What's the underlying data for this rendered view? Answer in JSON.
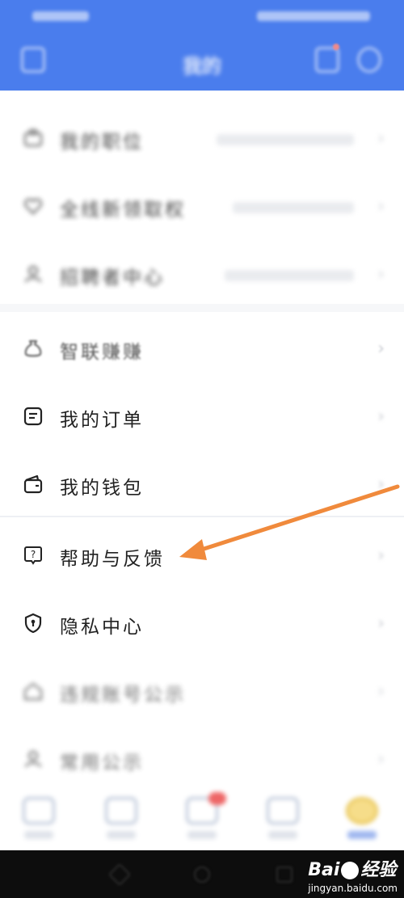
{
  "app_bar": {
    "title": "我的"
  },
  "menu_top": [
    {
      "id": "my-position",
      "label": "我的职位",
      "sub": "",
      "icon": "briefcase-icon"
    },
    {
      "id": "new-feature",
      "label": "全线新领取权",
      "sub": "",
      "icon": "heart-icon",
      "badge": ""
    },
    {
      "id": "center",
      "label": "招聘者中心",
      "sub": "",
      "icon": "person-icon"
    }
  ],
  "menu_main": [
    {
      "id": "zhilian-earn",
      "label": "智联赚赚",
      "icon": "money-bag-icon"
    },
    {
      "id": "my-orders",
      "label": "我的订单",
      "icon": "order-icon"
    },
    {
      "id": "my-wallet",
      "label": "我的钱包",
      "icon": "wallet-icon"
    }
  ],
  "menu_bottom": [
    {
      "id": "help-feedback",
      "label": "帮助与反馈",
      "icon": "help-icon"
    },
    {
      "id": "privacy-center",
      "label": "隐私中心",
      "icon": "shield-icon"
    },
    {
      "id": "violation",
      "label": "违规账号公示",
      "icon": "home-icon"
    },
    {
      "id": "announcement",
      "label": "常用公示",
      "icon": "user-icon"
    }
  ],
  "annotation": {
    "arrow_color": "#f08a3c"
  },
  "watermark": {
    "brand_left": "Bai",
    "brand_right": "经验",
    "url": "jingyan.baidu.com"
  },
  "colors": {
    "primary": "#4a7ded",
    "text": "#222222",
    "chevron": "#c8cbd1"
  }
}
